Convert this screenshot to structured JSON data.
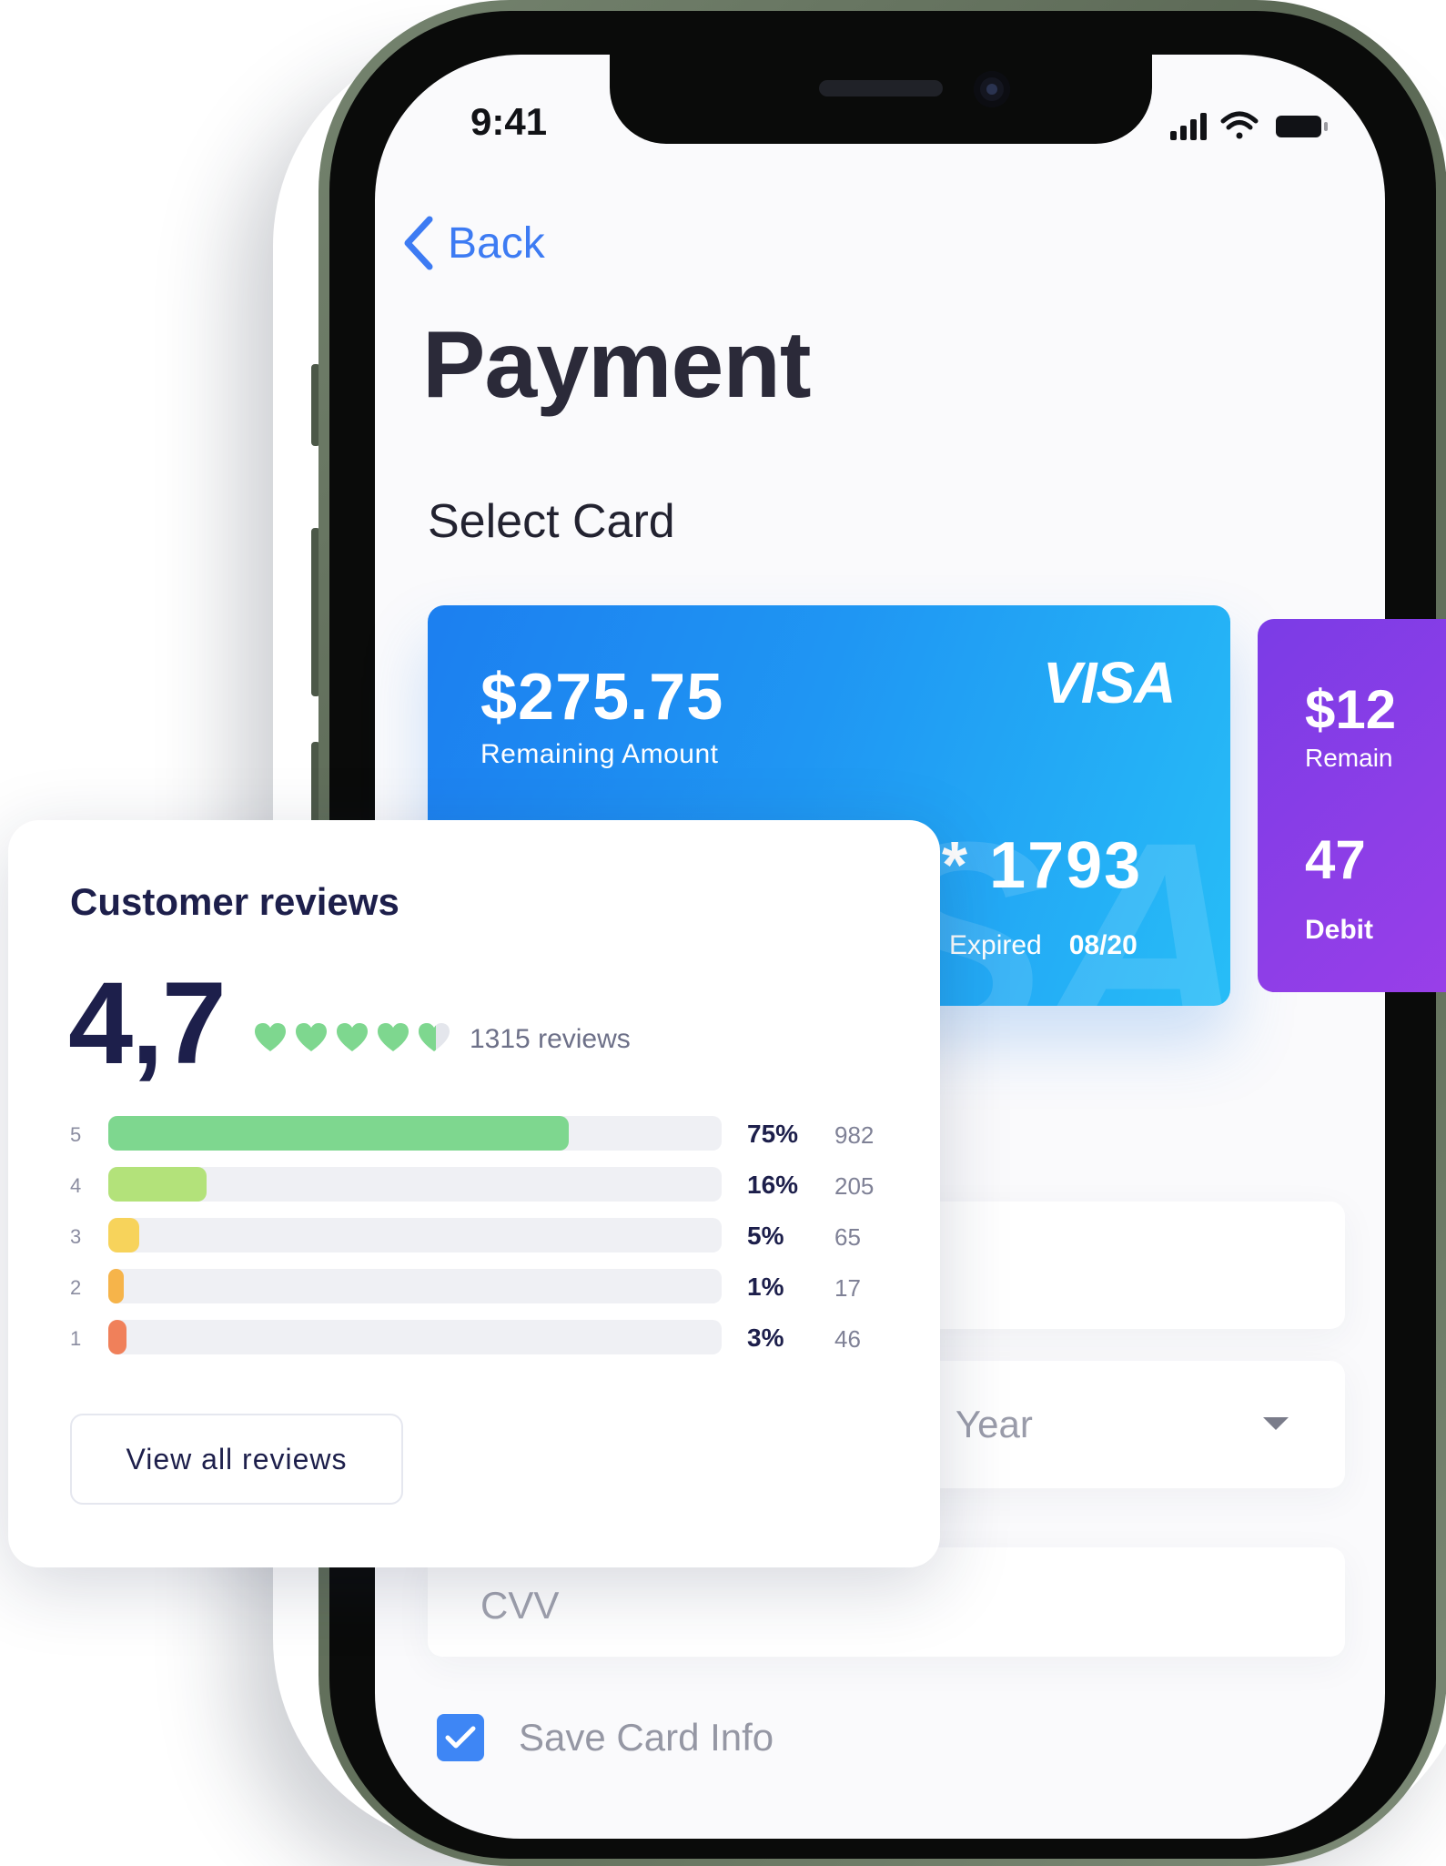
{
  "status_bar": {
    "time": "9:41"
  },
  "nav": {
    "back_label": "Back"
  },
  "page": {
    "title": "Payment",
    "select_card_label": "Select Card"
  },
  "cards": [
    {
      "amount": "$275.75",
      "amount_label": "Remaining Amount",
      "brand": "VISA",
      "number": "* 1793",
      "expiry_label": "Expired",
      "expiry_value": "08/20",
      "gradient": [
        "#1c7ff0",
        "#27bdf7"
      ]
    },
    {
      "amount": "$12",
      "amount_label": "Remain",
      "number": "47",
      "type": "Debit",
      "gradient": [
        "#7b3ce6",
        "#9a3fe8"
      ]
    }
  ],
  "form": {
    "year_placeholder": "Year",
    "cvv_placeholder": "CVV",
    "save_card_label": "Save Card Info",
    "save_card_checked": true
  },
  "reviews": {
    "title": "Customer reviews",
    "rating": "4,7",
    "rating_stars": 4.7,
    "reviews_count": "1315 reviews",
    "breakdown": [
      {
        "stars": "5",
        "percent": "75%",
        "count": "982",
        "fraction": 0.75,
        "color": "#7ed78f"
      },
      {
        "stars": "4",
        "percent": "16%",
        "count": "205",
        "fraction": 0.16,
        "color": "#b3e27a"
      },
      {
        "stars": "3",
        "percent": "5%",
        "count": "65",
        "fraction": 0.05,
        "color": "#f7d35b"
      },
      {
        "stars": "2",
        "percent": "1%",
        "count": "17",
        "fraction": 0.01,
        "color": "#f6b44a"
      },
      {
        "stars": "1",
        "percent": "3%",
        "count": "46",
        "fraction": 0.03,
        "color": "#f0805a"
      }
    ],
    "view_all_label": "View all reviews"
  },
  "colors": {
    "accent_blue": "#3d7bf3",
    "heart_green": "#7ed78f",
    "title_navy": "#1d1f4b"
  },
  "icons": {
    "back": "chevron-left-icon",
    "signal": "cellular-signal-icon",
    "wifi": "wifi-icon",
    "battery": "battery-icon",
    "rating": "heart-icon",
    "dropdown": "caret-down-icon",
    "checkbox": "checkmark-icon"
  }
}
